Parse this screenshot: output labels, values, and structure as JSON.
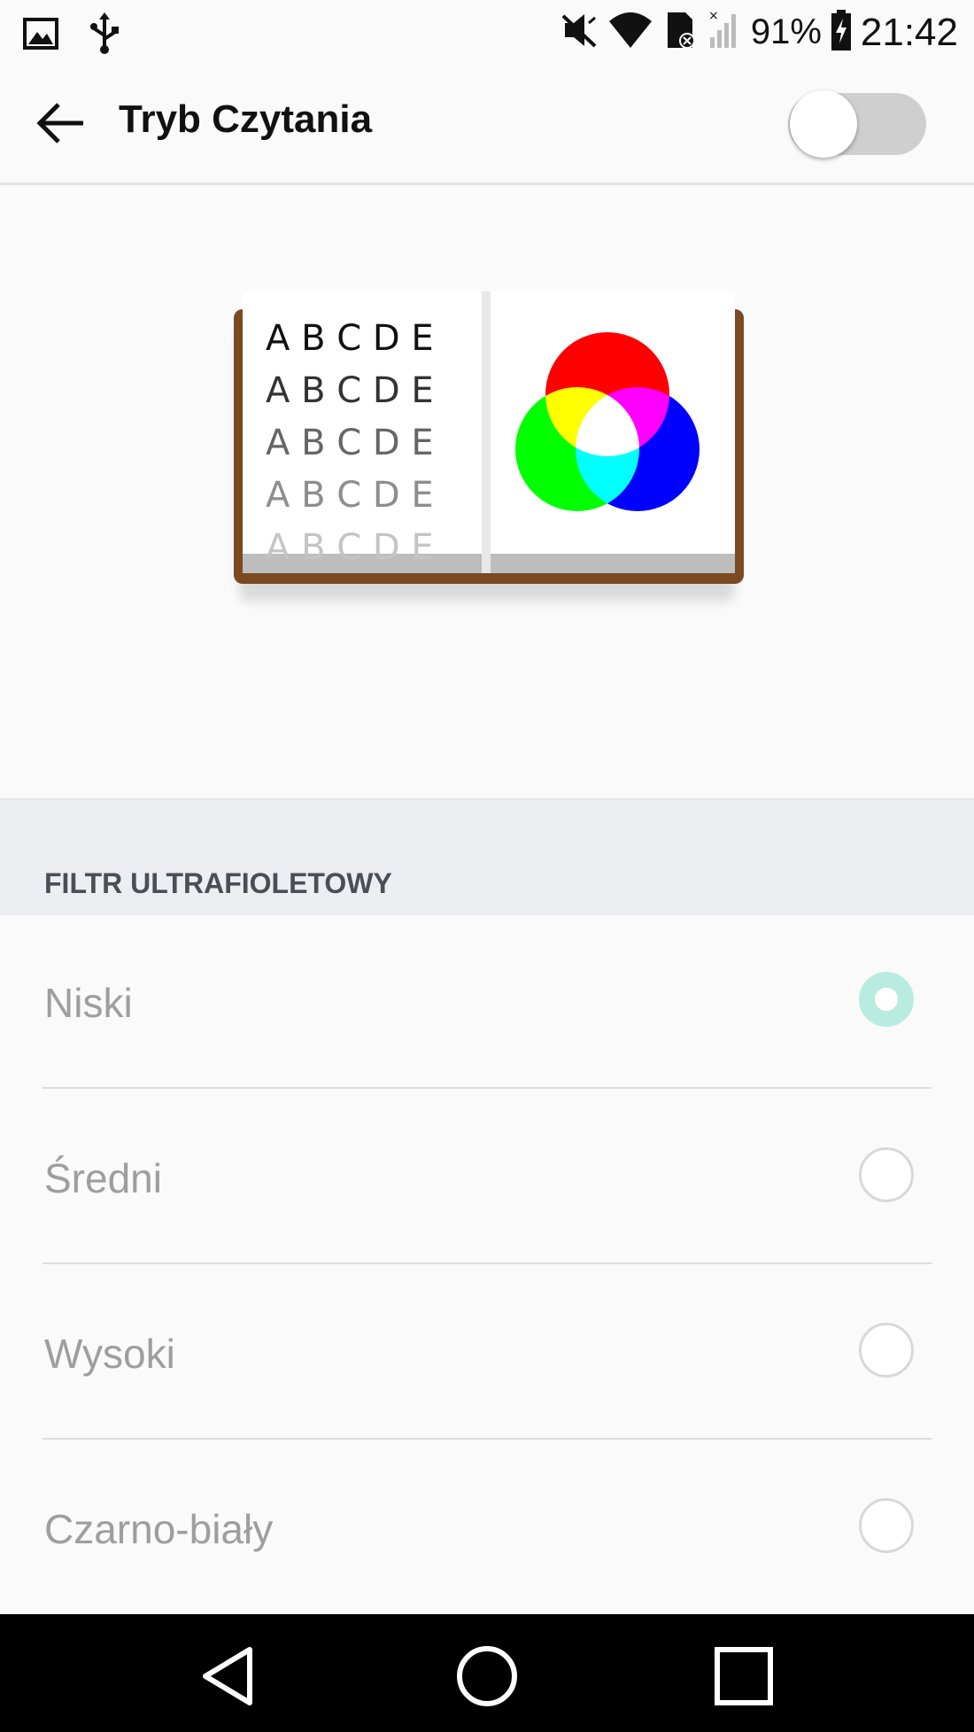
{
  "status_bar": {
    "battery_percent": "91%",
    "time": "21:42",
    "icons": [
      "image-icon",
      "usb-icon",
      "mute-icon",
      "wifi-icon",
      "sim-card-icon",
      "signal-icon",
      "battery-charging-icon"
    ]
  },
  "header": {
    "title": "Tryb Czytania",
    "back_icon": "arrow-back-icon",
    "toggle_on": false
  },
  "illustration": {
    "letter_rows": [
      "A B C D E",
      "A B C D E",
      "A B C D E",
      "A B C D E",
      "A B C D E"
    ],
    "letter_colors": [
      "#111111",
      "#333333",
      "#666666",
      "#8e8e8e",
      "#c4c4c4"
    ],
    "circle_colors": {
      "red": "#ff0000",
      "green": "#00ff00",
      "blue": "#0000ff"
    }
  },
  "section": {
    "title": "FILTR ULTRAFIOLETOWY"
  },
  "options": [
    {
      "label": "Niski",
      "selected": true
    },
    {
      "label": "Średni",
      "selected": false
    },
    {
      "label": "Wysoki",
      "selected": false
    },
    {
      "label": "Czarno-biały",
      "selected": false
    }
  ],
  "nav": {
    "icons": [
      "nav-back-icon",
      "nav-home-icon",
      "nav-recents-icon"
    ]
  },
  "colors": {
    "accent_radio": "#b9ece1",
    "section_bg": "#eceef1",
    "book_cover": "#7a4a22"
  }
}
